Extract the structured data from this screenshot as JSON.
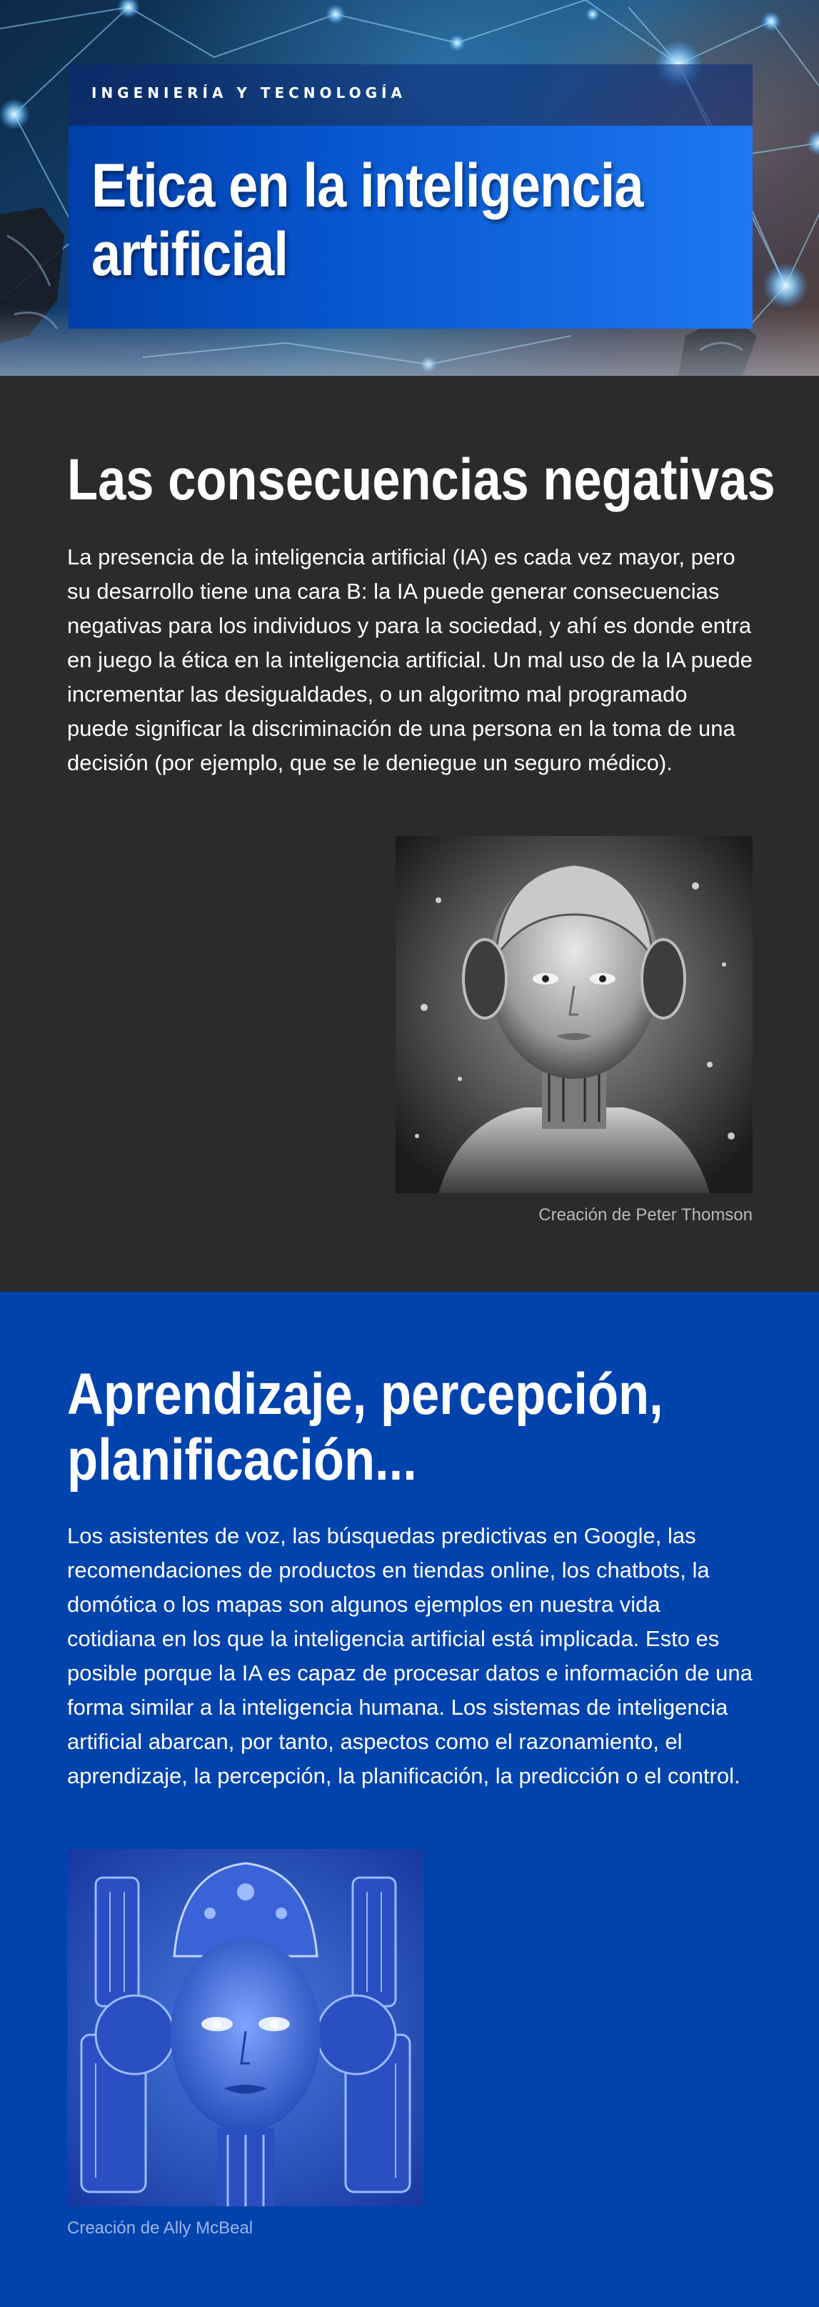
{
  "hero": {
    "kicker": "INGENIERÍA Y TECNOLOGÍA",
    "title_line1": "Etica en la inteligencia",
    "title_line2": "artificial"
  },
  "section1": {
    "heading": "Las consecuencias negativas",
    "paragraph": "La presencia de la inteligencia artificial (IA) es cada vez mayor, pero su desarrollo tiene una cara B: la IA puede generar consecuencias negativas para los individuos y para la sociedad, y ahí es donde entra en juego la ética en la inteligencia artificial. Un mal uso de la IA puede incrementar las desigualdades, o un algoritmo mal programado puede significar la discriminación de una persona en la toma de una decisión (por ejemplo, que se le deniegue un seguro médico).",
    "image_caption": "Creación de Peter Thomson"
  },
  "section2": {
    "heading_line1": "Aprendizaje, percepción,",
    "heading_line2": "planificación...",
    "paragraph": "Los asistentes de voz, las búsquedas predictivas en Google, las recomendaciones de productos en tiendas online, los chatbots, la domótica o los mapas son algunos ejemplos en nuestra vida cotidiana en los que la inteligencia artificial está implicada. Esto es posible porque la IA es capaz de procesar datos e información de una forma similar a la inteligencia humana. Los sistemas de inteligencia artificial abarcan, por tanto, aspectos como el razonamiento, el aprendizaje, la percepción, la planificación, la predicción o el control.",
    "image_caption": "Creación de Ally McBeal"
  },
  "colors": {
    "dark_bg": "#2b2b2b",
    "blue_bg": "#0043ad",
    "caption_dark": "#b8b8b8",
    "caption_blue": "#9fb4e6"
  }
}
